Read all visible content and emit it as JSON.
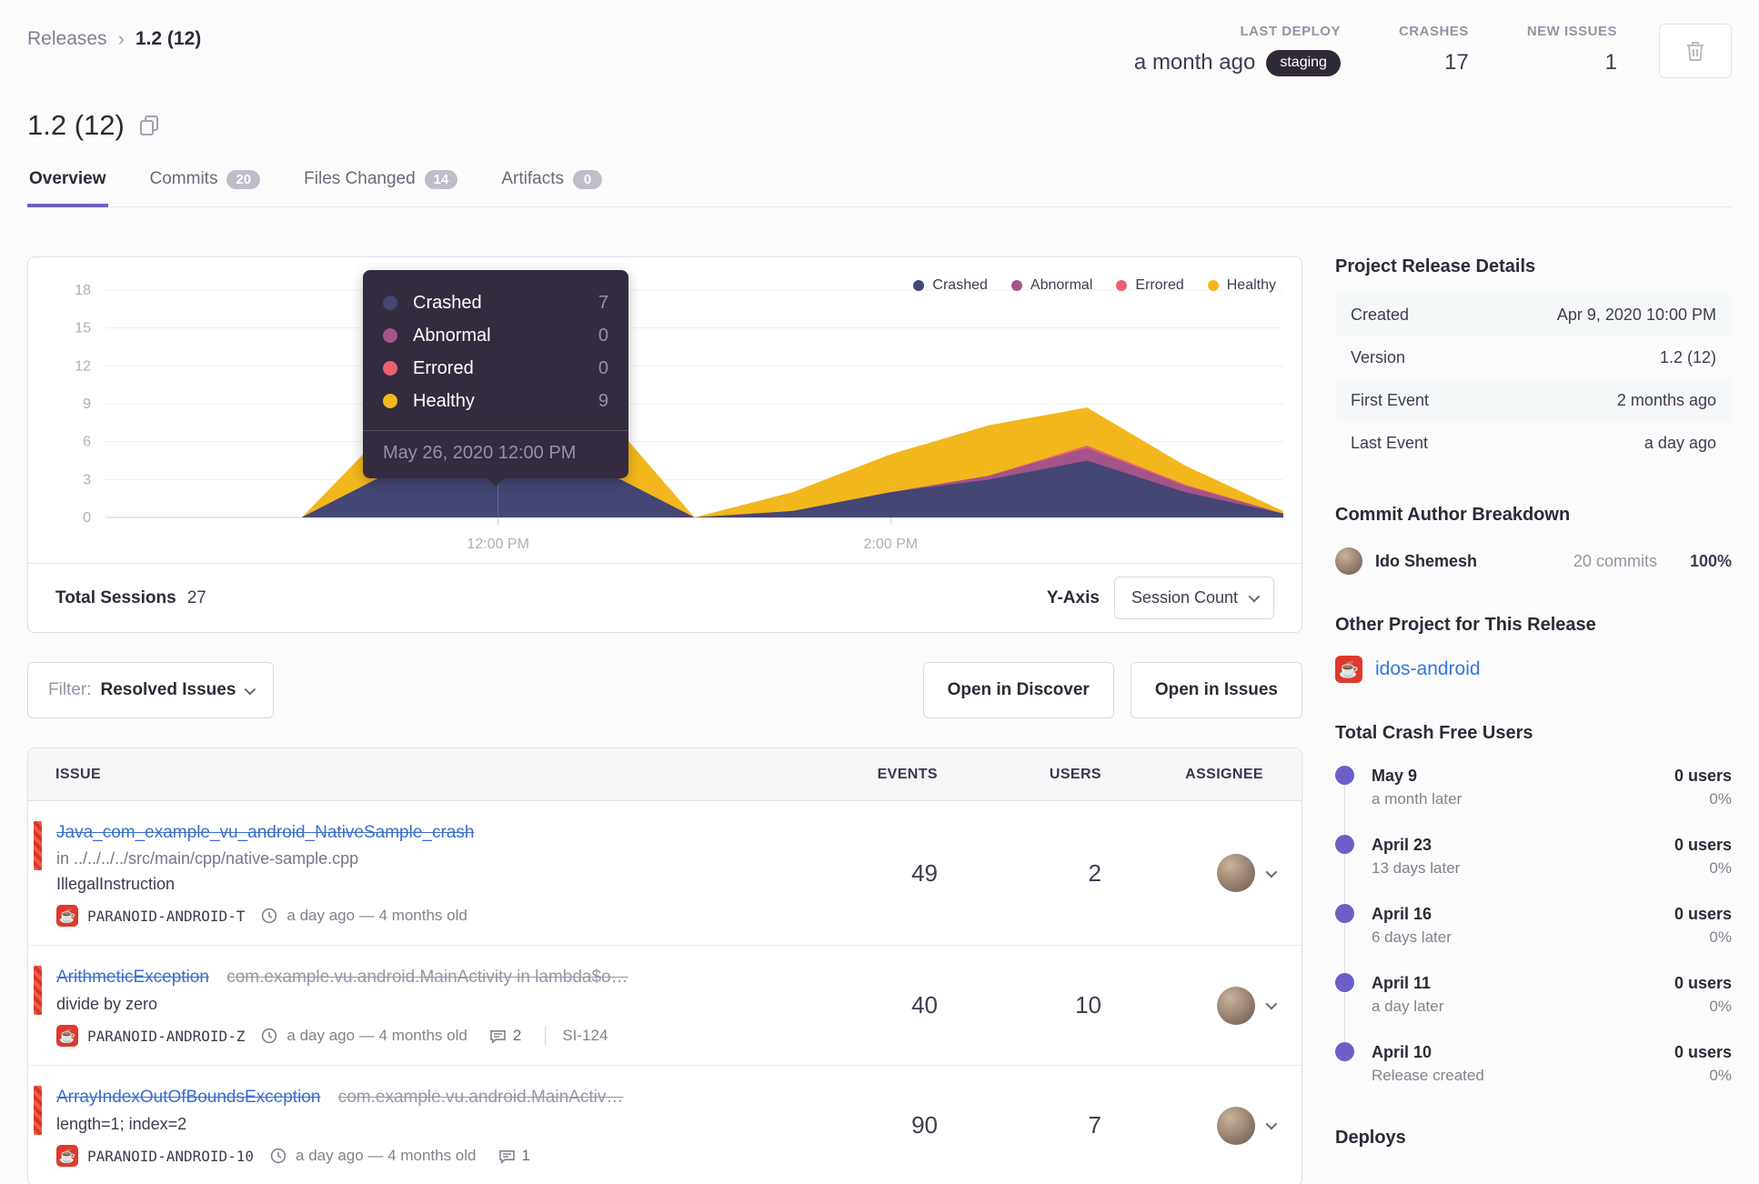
{
  "breadcrumb": {
    "parent": "Releases",
    "separator": "›",
    "current": "1.2 (12)"
  },
  "header_stats": {
    "last_deploy": {
      "label": "LAST DEPLOY",
      "value": "a month ago",
      "env": "staging"
    },
    "crashes": {
      "label": "CRASHES",
      "value": "17"
    },
    "new_issues": {
      "label": "NEW ISSUES",
      "value": "1"
    }
  },
  "page_title": "1.2 (12)",
  "tabs": [
    {
      "label": "Overview",
      "badge": null,
      "active": true
    },
    {
      "label": "Commits",
      "badge": "20",
      "active": false
    },
    {
      "label": "Files Changed",
      "badge": "14",
      "active": false
    },
    {
      "label": "Artifacts",
      "badge": "0",
      "active": false
    }
  ],
  "chart_card": {
    "tooltip_date": "May 26, 2020 12:00 PM",
    "total_sessions_label": "Total Sessions",
    "total_sessions_value": "27",
    "yaxis_label": "Y-Axis",
    "yaxis_dropdown": "Session Count"
  },
  "chart_data": {
    "type": "area",
    "stacked": true,
    "grid": true,
    "legend_position": "top-right",
    "x": [
      "10:00 AM",
      "10:30 AM",
      "11:00 AM",
      "11:30 AM",
      "12:00 PM",
      "12:30 PM",
      "1:00 PM",
      "1:30 PM",
      "2:00 PM",
      "2:30 PM",
      "3:00 PM",
      "3:30 PM",
      "4:00 PM"
    ],
    "x_shown_ticks": [
      "12:00 PM",
      "2:00 PM"
    ],
    "ylim": [
      0,
      18
    ],
    "yticks": [
      0,
      3,
      6,
      9,
      12,
      15,
      18
    ],
    "ylabel": "Session Count",
    "series": [
      {
        "name": "Crashed",
        "color": "#444674",
        "values": [
          0,
          0,
          0,
          4,
          7,
          4,
          0,
          0.5,
          2,
          3,
          4.5,
          2,
          0.3
        ]
      },
      {
        "name": "Abnormal",
        "color": "#a35488",
        "values": [
          0,
          0,
          0,
          0,
          0,
          0,
          0,
          0,
          0,
          0.3,
          1,
          0.5,
          0
        ]
      },
      {
        "name": "Errored",
        "color": "#e9626e",
        "values": [
          0,
          0,
          0,
          0,
          0,
          0,
          0,
          0,
          0,
          0,
          0.2,
          0.1,
          0
        ]
      },
      {
        "name": "Healthy",
        "color": "#f1b71c",
        "values": [
          0,
          0,
          0,
          4,
          9,
          5,
          0,
          1.5,
          3,
          4,
          3,
          1.5,
          0.2
        ]
      }
    ],
    "highlighted_point": {
      "x": "12:00 PM",
      "date_label": "May 26, 2020 12:00 PM",
      "values": {
        "Crashed": 7,
        "Abnormal": 0,
        "Errored": 0,
        "Healthy": 9
      }
    },
    "total_sessions": 27
  },
  "filter_bar": {
    "filter_label": "Filter:",
    "filter_value": "Resolved Issues",
    "open_in_discover": "Open in Discover",
    "open_in_issues": "Open in Issues"
  },
  "issues_table": {
    "columns": [
      "ISSUE",
      "EVENTS",
      "USERS",
      "ASSIGNEE"
    ],
    "rows": [
      {
        "title": "Java_com_example_vu_android_NativeSample_crash",
        "culprit": "",
        "location": "in ../../../../src/main/cpp/native-sample.cpp",
        "message": "IllegalInstruction",
        "project": "PARANOID-ANDROID-T",
        "age": "a day ago — 4 months old",
        "comments": null,
        "ticket": null,
        "events": "49",
        "users": "2"
      },
      {
        "title": "ArithmeticException",
        "culprit": "com.example.vu.android.MainActivity in lambda$o…",
        "location": "",
        "message": "divide by zero",
        "project": "PARANOID-ANDROID-Z",
        "age": "a day ago — 4 months old",
        "comments": "2",
        "ticket": "SI-124",
        "events": "40",
        "users": "10"
      },
      {
        "title": "ArrayIndexOutOfBoundsException",
        "culprit": "com.example.vu.android.MainActiv…",
        "location": "",
        "message": "length=1; index=2",
        "project": "PARANOID-ANDROID-10",
        "age": "a day ago — 4 months old",
        "comments": "1",
        "ticket": null,
        "events": "90",
        "users": "7"
      }
    ]
  },
  "sidebar": {
    "release_details": {
      "title": "Project Release Details",
      "rows": [
        {
          "label": "Created",
          "value": "Apr 9, 2020 10:00 PM"
        },
        {
          "label": "Version",
          "value": "1.2 (12)"
        },
        {
          "label": "First Event",
          "value": "2 months ago"
        },
        {
          "label": "Last Event",
          "value": "a day ago"
        }
      ]
    },
    "commit_authors": {
      "title": "Commit Author Breakdown",
      "authors": [
        {
          "name": "Ido Shemesh",
          "commits": "20 commits",
          "percent": "100%"
        }
      ]
    },
    "other_project": {
      "title": "Other Project for This Release",
      "project": "idos-android"
    },
    "crash_free_users": {
      "title": "Total Crash Free Users",
      "items": [
        {
          "date": "May 9",
          "sub": "a month later",
          "users": "0 users",
          "percent": "0%"
        },
        {
          "date": "April 23",
          "sub": "13 days later",
          "users": "0 users",
          "percent": "0%"
        },
        {
          "date": "April 16",
          "sub": "6 days later",
          "users": "0 users",
          "percent": "0%"
        },
        {
          "date": "April 11",
          "sub": "a day later",
          "users": "0 users",
          "percent": "0%"
        },
        {
          "date": "April 10",
          "sub": "Release created",
          "users": "0 users",
          "percent": "0%"
        }
      ]
    },
    "deploys_title": "Deploys"
  },
  "icons": {
    "project_icon_glyph": "☕",
    "trash": "trash-icon",
    "copy": "copy-icon",
    "clock": "clock-icon",
    "comment": "comment-bubble-icon",
    "chevron_down": "chevron-down-icon"
  },
  "colors": {
    "accent": "#6c5fc7",
    "link_blue": "#3b6ecc",
    "crashed": "#444674",
    "abnormal": "#a35488",
    "errored": "#e9626e",
    "healthy": "#f1b71c",
    "resolved_red": "#e0382c",
    "staging_pill_bg": "#2f2936",
    "tooltip_bg": "#342b3e"
  }
}
